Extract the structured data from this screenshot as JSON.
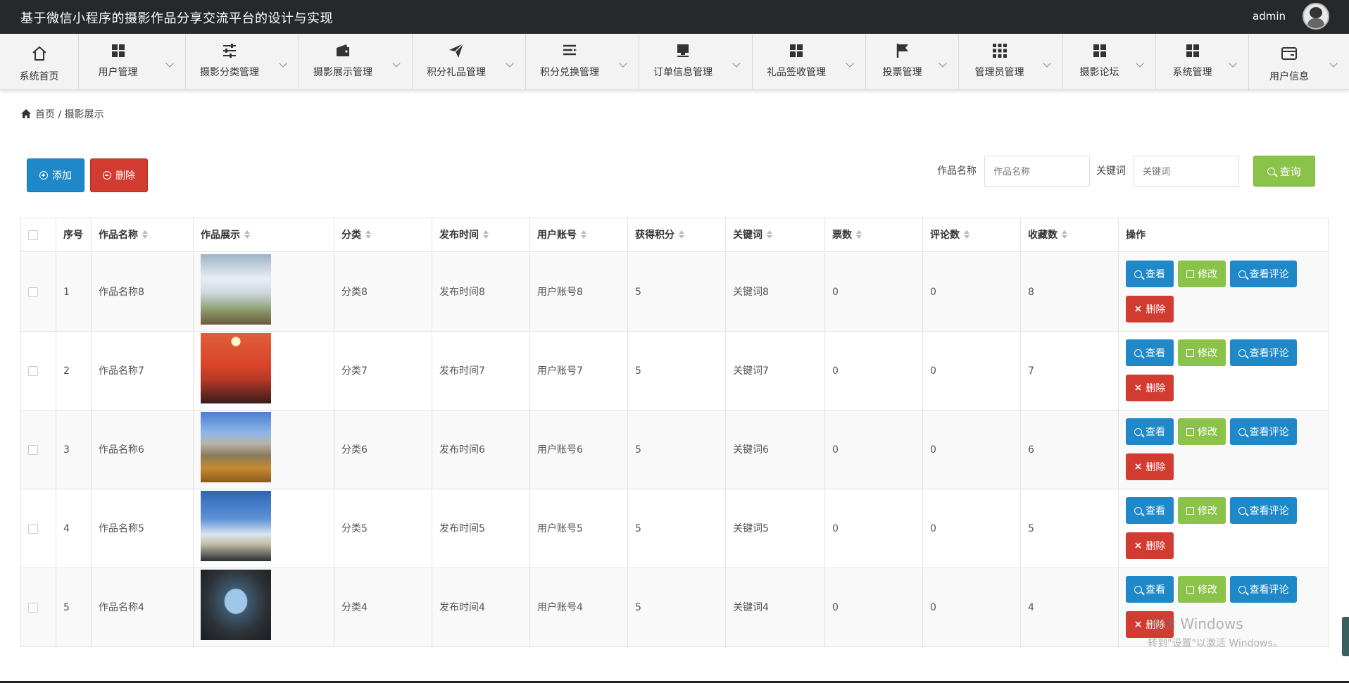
{
  "app": {
    "title": "基于微信小程序的摄影作品分享交流平台的设计与实现",
    "user": "admin"
  },
  "nav": [
    {
      "label": "系统首页",
      "icon": "home-icon"
    },
    {
      "label": "用户管理",
      "icon": "grid-icon"
    },
    {
      "label": "摄影分类管理",
      "icon": "sliders-icon"
    },
    {
      "label": "摄影展示管理",
      "icon": "wallet-icon"
    },
    {
      "label": "积分礼品管理",
      "icon": "paper-plane-icon"
    },
    {
      "label": "积分兑换管理",
      "icon": "list-icon"
    },
    {
      "label": "订单信息管理",
      "icon": "inbox-icon"
    },
    {
      "label": "礼品签收管理",
      "icon": "grid-icon"
    },
    {
      "label": "投票管理",
      "icon": "flag-icon"
    },
    {
      "label": "管理员管理",
      "icon": "apps-icon"
    },
    {
      "label": "摄影论坛",
      "icon": "grid-icon"
    },
    {
      "label": "系统管理",
      "icon": "grid-icon"
    },
    {
      "label": "用户信息",
      "icon": "card-icon"
    }
  ],
  "breadcrumb": {
    "home": "首页",
    "separator": "/",
    "current": "摄影展示"
  },
  "toolbar": {
    "add_label": "添加",
    "delete_label": "删除"
  },
  "filters": {
    "name_label": "作品名称",
    "name_placeholder": "作品名称",
    "keyword_label": "关键词",
    "keyword_placeholder": "关键词",
    "search_label": "查询"
  },
  "table": {
    "headers": [
      "序号",
      "作品名称",
      "作品展示",
      "分类",
      "发布时间",
      "用户账号",
      "获得积分",
      "关键词",
      "票数",
      "评论数",
      "收藏数",
      "操作"
    ],
    "actions": {
      "view": "查看",
      "edit": "修改",
      "comments": "查看评论",
      "delete": "删除"
    },
    "rows": [
      {
        "index": "1",
        "name": "作品名称8",
        "category": "分类8",
        "time": "发布时间8",
        "account": "用户账号8",
        "points": "5",
        "keyword": "关键词8",
        "votes": "0",
        "comments": "0",
        "favorites": "8"
      },
      {
        "index": "2",
        "name": "作品名称7",
        "category": "分类7",
        "time": "发布时间7",
        "account": "用户账号7",
        "points": "5",
        "keyword": "关键词7",
        "votes": "0",
        "comments": "0",
        "favorites": "7"
      },
      {
        "index": "3",
        "name": "作品名称6",
        "category": "分类6",
        "time": "发布时间6",
        "account": "用户账号6",
        "points": "5",
        "keyword": "关键词6",
        "votes": "0",
        "comments": "0",
        "favorites": "6"
      },
      {
        "index": "4",
        "name": "作品名称5",
        "category": "分类5",
        "time": "发布时间5",
        "account": "用户账号5",
        "points": "5",
        "keyword": "关键词5",
        "votes": "0",
        "comments": "0",
        "favorites": "5"
      },
      {
        "index": "5",
        "name": "作品名称4",
        "category": "分类4",
        "time": "发布时间4",
        "account": "用户账号4",
        "points": "5",
        "keyword": "关键词4",
        "votes": "0",
        "comments": "0",
        "favorites": "4"
      }
    ]
  },
  "watermark": {
    "line1": "激活 Windows",
    "line2": "转到\"设置\"以激活 Windows。"
  },
  "colors": {
    "topbar": "#26292c",
    "primary": "#1e88c8",
    "danger": "#d23b2f",
    "success": "#8bc34a"
  }
}
